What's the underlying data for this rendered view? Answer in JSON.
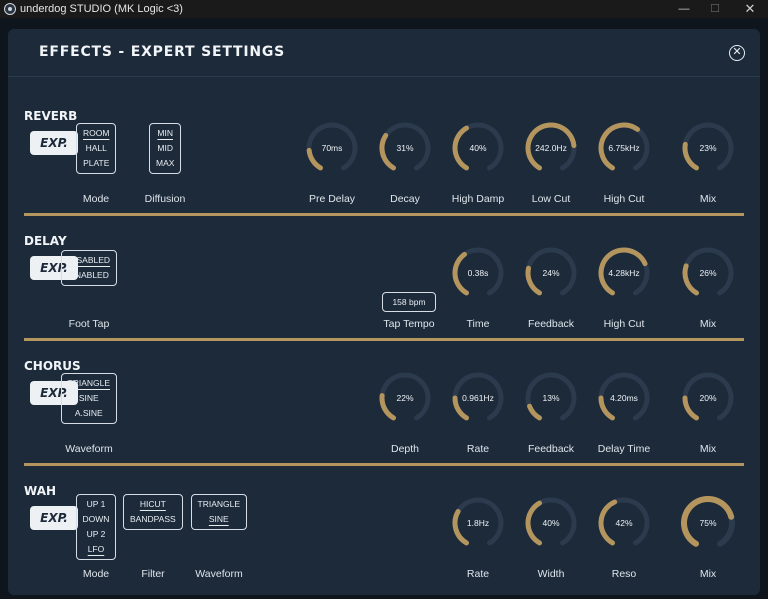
{
  "window": {
    "title": "underdog STUDIO (MK Logic <3)"
  },
  "panel": {
    "title": "EFFECTS - EXPERT SETTINGS"
  },
  "colors": {
    "accent": "#b4955e",
    "track": "#2b3a4d",
    "panel": "#1c2a3a",
    "text": "#e8edf2"
  },
  "icons": {
    "close": "close-circle-icon",
    "app": "app-icon"
  },
  "exp_label": "EXP.",
  "sections": [
    {
      "key": "reverb",
      "name": "REVERB",
      "groups": [
        {
          "id": "mode",
          "label": "Mode",
          "options": [
            "ROOM",
            "HALL",
            "PLATE"
          ],
          "selected": "ROOM"
        },
        {
          "id": "diffusion",
          "label": "Diffusion",
          "options": [
            "MIN",
            "MID",
            "MAX"
          ],
          "selected": "MIN"
        }
      ],
      "knobs": [
        {
          "id": "pre-delay",
          "label": "Pre Delay",
          "value": "70ms",
          "fill": 0.18
        },
        {
          "id": "decay",
          "label": "Decay",
          "value": "31%",
          "fill": 0.31
        },
        {
          "id": "high-damp",
          "label": "High Damp",
          "value": "40%",
          "fill": 0.4
        },
        {
          "id": "low-cut",
          "label": "Low Cut",
          "value": "242.0Hz",
          "fill": 0.78
        },
        {
          "id": "high-cut",
          "label": "High Cut",
          "value": "6.75kHz",
          "fill": 0.62
        },
        {
          "id": "mix",
          "label": "Mix",
          "value": "23%",
          "fill": 0.23
        }
      ]
    },
    {
      "key": "delay",
      "name": "DELAY",
      "groups": [
        {
          "id": "foot-tap",
          "label": "Foot Tap",
          "options": [
            "DISABLED",
            "ENABLED"
          ],
          "selected": "DISABLED"
        }
      ],
      "tap_tempo": {
        "label": "Tap Tempo",
        "value": "158 bpm"
      },
      "knobs": [
        {
          "id": "time",
          "label": "Time",
          "value": "0.38s",
          "fill": 0.38
        },
        {
          "id": "feedback",
          "label": "Feedback",
          "value": "24%",
          "fill": 0.24
        },
        {
          "id": "high-cut",
          "label": "High Cut",
          "value": "4.28kHz",
          "fill": 0.72
        },
        {
          "id": "mix",
          "label": "Mix",
          "value": "26%",
          "fill": 0.26
        }
      ]
    },
    {
      "key": "chorus",
      "name": "CHORUS",
      "groups": [
        {
          "id": "waveform",
          "label": "Waveform",
          "options": [
            "TRIANGLE",
            "SINE",
            "A.SINE"
          ],
          "selected": "TRIANGLE"
        }
      ],
      "knobs": [
        {
          "id": "depth",
          "label": "Depth",
          "value": "22%",
          "fill": 0.22
        },
        {
          "id": "rate",
          "label": "Rate",
          "value": "0.961Hz",
          "fill": 0.2
        },
        {
          "id": "feedback",
          "label": "Feedback",
          "value": "13%",
          "fill": 0.13
        },
        {
          "id": "delay-time",
          "label": "Delay Time",
          "value": "4.20ms",
          "fill": 0.2
        },
        {
          "id": "mix",
          "label": "Mix",
          "value": "20%",
          "fill": 0.2
        }
      ]
    },
    {
      "key": "wah",
      "name": "WAH",
      "groups": [
        {
          "id": "mode",
          "label": "Mode",
          "options": [
            "UP 1",
            "DOWN",
            "UP 2",
            "LFO"
          ],
          "selected": "LFO"
        },
        {
          "id": "filter",
          "label": "Filter",
          "options": [
            "HICUT",
            "BANDPASS"
          ],
          "selected": "HICUT"
        },
        {
          "id": "waveform",
          "label": "Waveform",
          "options": [
            "TRIANGLE",
            "SINE"
          ],
          "selected": "SINE"
        }
      ],
      "knobs": [
        {
          "id": "rate",
          "label": "Rate",
          "value": "1.8Hz",
          "fill": 0.3
        },
        {
          "id": "width",
          "label": "Width",
          "value": "40%",
          "fill": 0.4
        },
        {
          "id": "reso",
          "label": "Reso",
          "value": "42%",
          "fill": 0.42
        },
        {
          "id": "mix",
          "label": "Mix",
          "value": "75%",
          "fill": 0.75
        }
      ]
    }
  ]
}
